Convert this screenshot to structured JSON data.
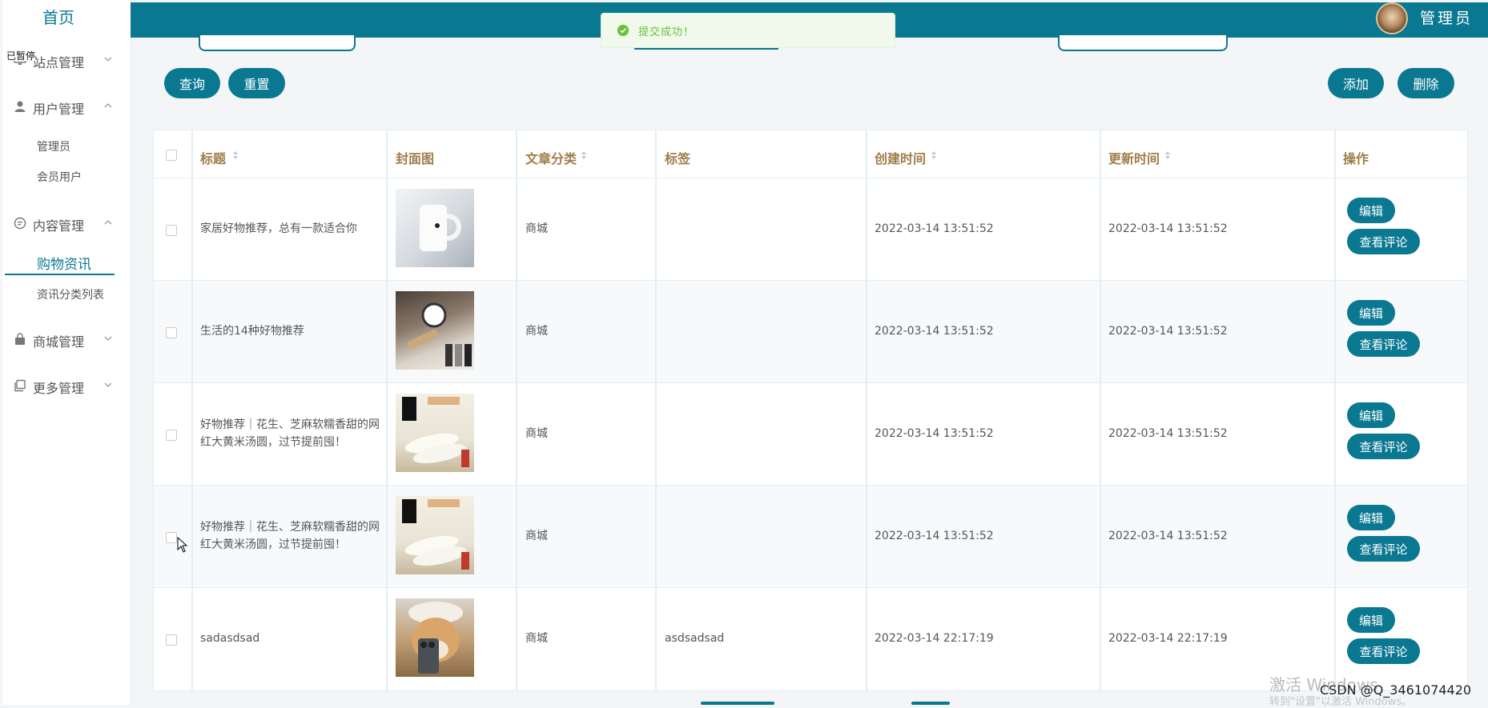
{
  "sidebar": {
    "home": "首页",
    "ime_indicator": "已暂停",
    "groups": [
      {
        "label": "站点管理",
        "icon": "monitor-icon",
        "expanded": false
      },
      {
        "label": "用户管理",
        "icon": "user-icon",
        "expanded": true
      },
      {
        "label": "内容管理",
        "icon": "chat-icon",
        "expanded": true
      },
      {
        "label": "商城管理",
        "icon": "bag-icon",
        "expanded": false
      },
      {
        "label": "更多管理",
        "icon": "copy-icon",
        "expanded": false
      }
    ],
    "user_items": [
      "管理员",
      "会员用户"
    ],
    "content_items": [
      "购物资讯",
      "资讯分类列表"
    ],
    "active_item": "购物资讯"
  },
  "header": {
    "user_name": "管理员",
    "avatar": "user-avatar-photo"
  },
  "toast": {
    "message": "提交成功！",
    "type": "success",
    "color": "#67c23a"
  },
  "toolbar": {
    "query": "查询",
    "reset": "重置",
    "add": "添加",
    "delete": "删除"
  },
  "theme": {
    "accent": "#0b7891"
  },
  "table": {
    "headers": {
      "title": "标题",
      "cover": "封面图",
      "category": "文章分类",
      "tags": "标签",
      "created": "创建时间",
      "updated": "更新时间",
      "actions": "操作"
    },
    "rows": [
      {
        "title": "家居好物推荐，总有一款适合你",
        "cover": "white-mug-photo",
        "category": "商城",
        "tags": "",
        "created": "2022-03-14 13:51:52",
        "updated": "2022-03-14 13:51:52"
      },
      {
        "title": "生活的14种好物推荐",
        "cover": "desk-items-photo",
        "category": "商城",
        "tags": "",
        "created": "2022-03-14 13:51:52",
        "updated": "2022-03-14 13:51:52"
      },
      {
        "title": "好物推荐｜花生、芝麻软糯香甜的网红大黄米汤圆，过节提前囤！",
        "cover": "rice-cake-photo",
        "category": "商城",
        "tags": "",
        "created": "2022-03-14 13:51:52",
        "updated": "2022-03-14 13:51:52"
      },
      {
        "title": "好物推荐｜花生、芝麻软糯香甜的网红大黄米汤圆，过节提前囤！",
        "cover": "rice-cake-photo",
        "category": "商城",
        "tags": "",
        "created": "2022-03-14 13:51:52",
        "updated": "2022-03-14 13:51:52"
      },
      {
        "title": "sadasdsad",
        "cover": "dog-phone-photo",
        "category": "商城",
        "tags": "asdsadsad",
        "created": "2022-03-14 22:17:19",
        "updated": "2022-03-14 22:17:19"
      }
    ],
    "edit_label": "编辑",
    "comments_label": "查看评论"
  },
  "watermark": {
    "activate": "激活 Windows",
    "activate_sub": "转到\"设置\"以激活 Windows。",
    "csdn": "CSDN @Q_3461074420"
  }
}
